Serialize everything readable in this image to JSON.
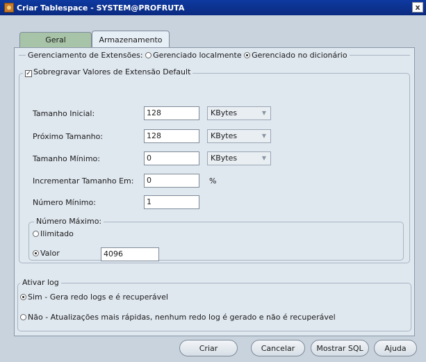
{
  "window": {
    "title": "Criar Tablespace - SYSTEM@PROFRUTA",
    "close_glyph": "x"
  },
  "tabs": [
    {
      "label": "Geral"
    },
    {
      "label": "Armazenamento"
    }
  ],
  "extents": {
    "label": "Gerenciamento de Extensões:",
    "opt_local": "Gerenciado localmente",
    "opt_dict": "Gerenciado no dicionário",
    "selected": "dict"
  },
  "override": {
    "label": "Sobregravar Valores de Extensão Default",
    "checked": true,
    "check_glyph": "✓",
    "initial_label": "Tamanho Inicial:",
    "initial_value": "128",
    "initial_unit": "KBytes",
    "next_label": "Próximo Tamanho:",
    "next_value": "128",
    "next_unit": "KBytes",
    "min_label": "Tamanho Mínimo:",
    "min_value": "0",
    "min_unit": "KBytes",
    "increment_label": "Incrementar Tamanho Em:",
    "increment_value": "0",
    "increment_unit": "%",
    "min_count_label": "Número Mínimo:",
    "min_count_value": "1",
    "max": {
      "label": "Número Máximo:",
      "unlimited": "Ilimitado",
      "value_label": "Valor",
      "value": "4096",
      "selected": "value"
    }
  },
  "logging": {
    "label": "Ativar log",
    "yes": "Sim - Gera redo logs e é recuperável",
    "no": "Não - Atualizações mais rápidas, nenhum redo log é gerado e não é recuperável",
    "selected": "yes"
  },
  "buttons": {
    "create": "Criar",
    "cancel": "Cancelar",
    "show_sql": "Mostrar SQL",
    "help": "Ajuda"
  },
  "dropdown_arrow": "▼"
}
